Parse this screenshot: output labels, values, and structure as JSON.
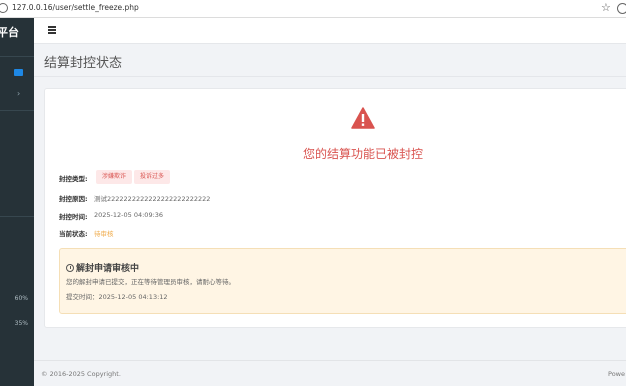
{
  "browser": {
    "url": "127.0.0.16/user/settle_freeze.php"
  },
  "sidebar": {
    "brand": "平台",
    "badge": "",
    "percent_1": "60%",
    "percent_2": "35%"
  },
  "page": {
    "title": "结算封控状态"
  },
  "status_card": {
    "headline": "您的结算功能已被封控",
    "type_label": "封控类型:",
    "type_tags": [
      "涉嫌欺诈",
      "投诉过多"
    ],
    "reason_label": "封控原因:",
    "reason_value": "测试2222222222222222222222222",
    "time_label": "封控时间:",
    "time_value": "2025-12-05 04:09:36",
    "state_label": "当前状态:",
    "state_value": "待审核"
  },
  "appeal_notice": {
    "title": "解封申请审核中",
    "message": "您的解封申请已提交，正在等待管理员审核，请耐心等待。",
    "submit_time": "提交时间：2025-12-05 04:13:12"
  },
  "footer": {
    "copyright": "© 2016-2025 Copyright.",
    "powered": "Powe"
  },
  "colors": {
    "sidebar_bg": "#263238",
    "danger": "#d9534f",
    "warning": "#f0ad4e",
    "notice_bg": "#fff5e4"
  }
}
